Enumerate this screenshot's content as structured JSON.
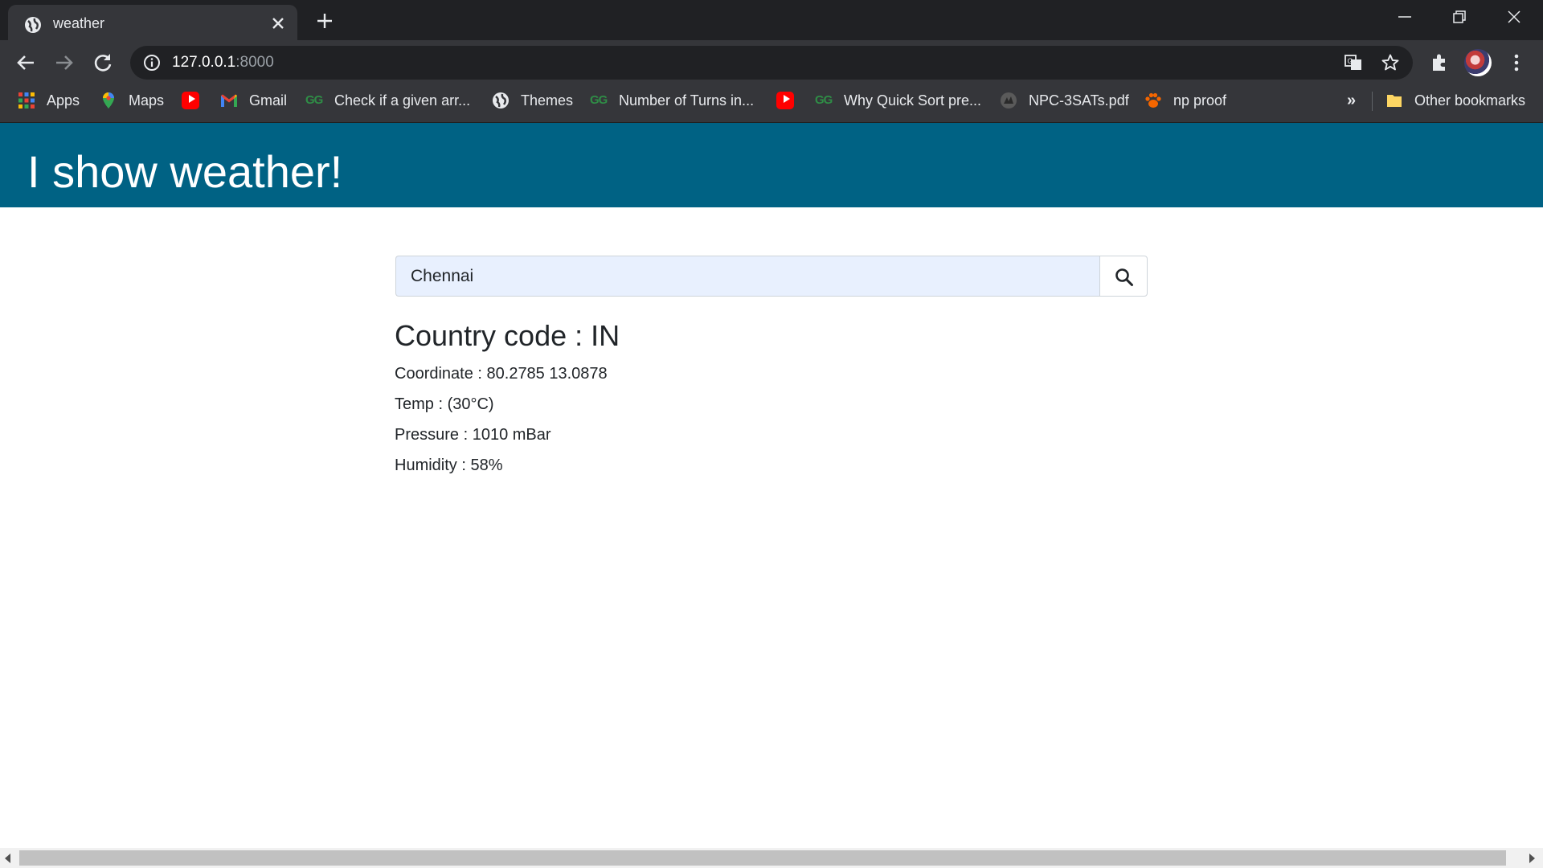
{
  "browser": {
    "tab": {
      "title": "weather",
      "icon": "globe-icon"
    },
    "url": {
      "host": "127.0.0.1",
      "port": ":8000"
    },
    "bookmarks": [
      {
        "label": "Apps",
        "icon": "apps-grid-icon"
      },
      {
        "label": "Maps",
        "icon": "maps-pin-icon"
      },
      {
        "label": "",
        "icon": "youtube-icon"
      },
      {
        "label": "Gmail",
        "icon": "gmail-icon"
      },
      {
        "label": "Check if a given arr...",
        "icon": "geeksforgeeks-icon"
      },
      {
        "label": "Themes",
        "icon": "globe-icon"
      },
      {
        "label": "Number of Turns in...",
        "icon": "geeksforgeeks-icon"
      },
      {
        "label": "",
        "icon": "youtube-icon"
      },
      {
        "label": "Why Quick Sort pre...",
        "icon": "geeksforgeeks-icon"
      },
      {
        "label": "NPC-3SATs.pdf",
        "icon": "pdf-site-icon"
      },
      {
        "label": "np proof",
        "icon": "paw-icon"
      }
    ],
    "bookmarks_more": "»",
    "other_bookmarks": "Other bookmarks"
  },
  "page": {
    "title": "I show weather!",
    "search": {
      "value": "Chennai"
    },
    "country_line": "Country code : IN",
    "coordinate_line": "Coordinate : 80.2785 13.0878",
    "temp_line": "Temp : (30°C)",
    "pressure_line": "Pressure : 1010 mBar",
    "humidity_line": "Humidity : 58%"
  },
  "colors": {
    "header_bg": "#006284",
    "browser_frame": "#35363a",
    "input_bg": "#e8f0fe"
  }
}
